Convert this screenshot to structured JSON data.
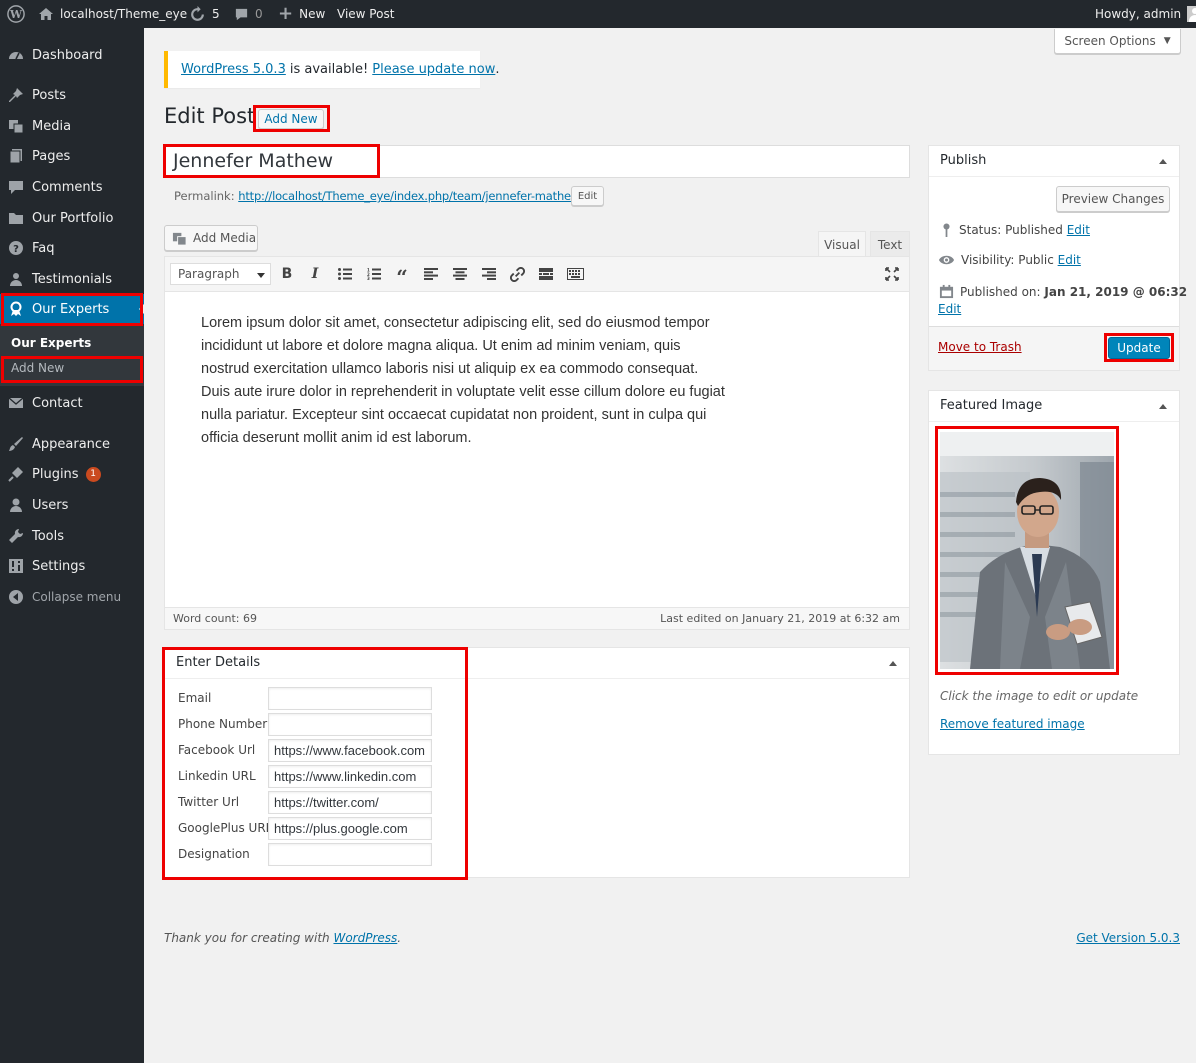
{
  "adminbar": {
    "site_name": "localhost/Theme_eye",
    "updates_count": "5",
    "comments_count": "0",
    "new_label": "New",
    "view_post_label": "View Post",
    "howdy": "Howdy, admin"
  },
  "sidebar": {
    "items": [
      {
        "label": "Dashboard",
        "icon": "dashboard-icon"
      },
      {
        "label": "Posts",
        "icon": "pin-icon"
      },
      {
        "label": "Media",
        "icon": "media-icon"
      },
      {
        "label": "Pages",
        "icon": "pages-icon"
      },
      {
        "label": "Comments",
        "icon": "comment-icon"
      },
      {
        "label": "Our Portfolio",
        "icon": "folder-icon"
      },
      {
        "label": "Faq",
        "icon": "help-icon"
      },
      {
        "label": "Testimonials",
        "icon": "users-icon"
      },
      {
        "label": "Our Experts",
        "icon": "award-icon"
      },
      {
        "label": "Contact",
        "icon": "mail-icon"
      },
      {
        "label": "Appearance",
        "icon": "brush-icon"
      },
      {
        "label": "Plugins",
        "icon": "plugin-icon",
        "badge": "1"
      },
      {
        "label": "Users",
        "icon": "user-icon"
      },
      {
        "label": "Tools",
        "icon": "wrench-icon"
      },
      {
        "label": "Settings",
        "icon": "settings-icon"
      },
      {
        "label": "Collapse menu",
        "icon": "collapse-icon"
      }
    ],
    "submenu": {
      "current": "Our Experts",
      "add_new": "Add New"
    }
  },
  "screen_options": "Screen Options",
  "notice": {
    "version_link": "WordPress 5.0.3",
    "middle": "is available!",
    "update_link": "Please update now",
    "end": "."
  },
  "heading": {
    "title": "Edit Post",
    "add_new": "Add New"
  },
  "post": {
    "title": "Jennefer Mathew",
    "permalink_label": "Permalink:",
    "permalink_url": "http://localhost/Theme_eye/index.php/team/jennefer-mathew/",
    "permalink_edit": "Edit"
  },
  "editor": {
    "add_media": "Add Media",
    "tab_visual": "Visual",
    "tab_text": "Text",
    "format": "Paragraph",
    "content": "Lorem ipsum dolor sit amet, consectetur adipiscing elit, sed do eiusmod tempor incididunt ut labore et dolore magna aliqua. Ut enim ad minim veniam, quis nostrud exercitation ullamco laboris nisi ut aliquip ex ea commodo consequat. Duis aute irure dolor in reprehenderit in voluptate velit esse cillum dolore eu fugiat nulla pariatur. Excepteur sint occaecat cupidatat non proident, sunt in culpa qui officia deserunt mollit anim id est laborum.",
    "word_count": "Word count: 69",
    "last_edited": "Last edited on January 21, 2019 at 6:32 am"
  },
  "details": {
    "title": "Enter Details",
    "fields": [
      {
        "label": "Email",
        "value": ""
      },
      {
        "label": "Phone Number",
        "value": ""
      },
      {
        "label": "Facebook Url",
        "value": "https://www.facebook.com"
      },
      {
        "label": "Linkedin URL",
        "value": "https://www.linkedin.com"
      },
      {
        "label": "Twitter Url",
        "value": "https://twitter.com/"
      },
      {
        "label": "GooglePlus URL",
        "value": "https://plus.google.com"
      },
      {
        "label": "Designation",
        "value": ""
      }
    ]
  },
  "publish": {
    "title": "Publish",
    "preview": "Preview Changes",
    "status_label": "Status:",
    "status_value": "Published",
    "visibility_label": "Visibility:",
    "visibility_value": "Public",
    "published_on_label": "Published on:",
    "published_on_value": "Jan 21, 2019 @ 06:32",
    "edit": "Edit",
    "trash": "Move to Trash",
    "update": "Update"
  },
  "featured": {
    "title": "Featured Image",
    "hint": "Click the image to edit or update",
    "remove": "Remove featured image"
  },
  "footer": {
    "thanks": "Thank you for creating with",
    "wp_link": "WordPress",
    "thanks_end": ".",
    "version": "Get Version 5.0.3"
  },
  "colors": {
    "accent": "#0073aa",
    "sidebar_bg": "#23282d",
    "highlight": "#e00000"
  }
}
